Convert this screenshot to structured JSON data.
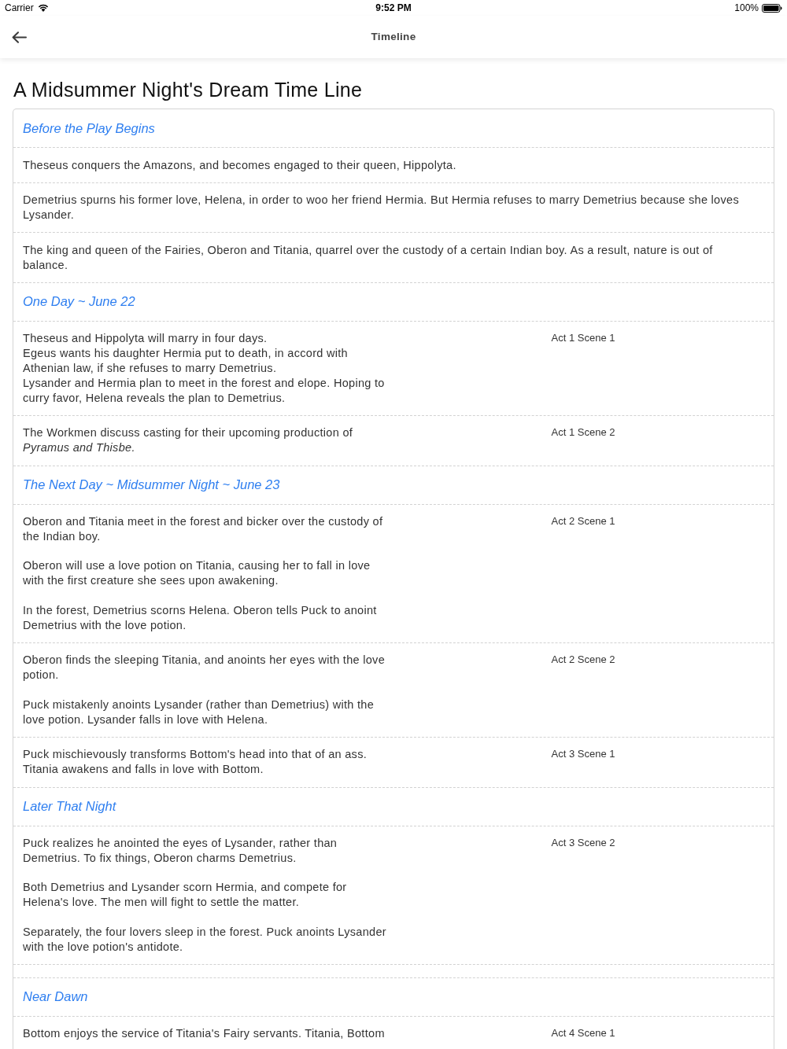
{
  "status_bar": {
    "carrier": "Carrier",
    "time": "9:52 PM",
    "battery": "100%"
  },
  "nav_bar": {
    "title": "Timeline"
  },
  "page_title": "A Midsummer Night's Dream Time Line",
  "sections": [
    {
      "title": "Before the Play Begins",
      "rows": [
        {
          "kind": "event",
          "text": "Theseus conquers the Amazons, and becomes engaged to their queen, Hippolyta."
        },
        {
          "kind": "event",
          "text": "Demetrius spurns his former love, Helena, in order to woo her friend Hermia. But Hermia refuses to marry Demetrius because she loves Lysander."
        },
        {
          "kind": "event",
          "text": "The king and queen of the Fairies, Oberon and Titania, quarrel over the custody of a certain Indian boy. As a result, nature is out of balance."
        }
      ]
    },
    {
      "title": "One Day ~ June 22",
      "rows": [
        {
          "kind": "event",
          "text": "Theseus and Hippolyta will marry in four days.\nEgeus wants his daughter Hermia put to death, in accord with Athenian law, if she refuses to marry Demetrius.\nLysander and Hermia plan to meet in the forest and elope. Hoping to curry favor, Helena reveals the plan to Demetrius.",
          "scene": "Act 1 Scene 1"
        },
        {
          "kind": "event",
          "text": "The Workmen discuss casting for their upcoming production of *Pyramus and Thisbe.*",
          "scene": "Act 1 Scene 2"
        }
      ]
    },
    {
      "title": "The Next Day ~ Midsummer Night ~ June 23",
      "rows": [
        {
          "kind": "event",
          "text": "Oberon and Titania meet in the forest and bicker over the custody of the Indian boy.\n\nOberon will use a love potion on Titania, causing her to fall in love with the first creature she sees upon awakening.\n\nIn the forest, Demetrius scorns Helena. Oberon tells Puck to anoint Demetrius with the love potion.",
          "scene": "Act 2 Scene 1"
        },
        {
          "kind": "event",
          "text": "Oberon finds the sleeping Titania, and anoints her eyes with the love potion.\n\nPuck mistakenly anoints Lysander (rather than Demetrius) with the love potion. Lysander falls in love with Helena.",
          "scene": "Act 2 Scene 2"
        },
        {
          "kind": "event",
          "text": "Puck mischievously transforms Bottom's head into that of an ass.\nTitania awakens and falls in love with Bottom.",
          "scene": "Act 3 Scene 1"
        }
      ]
    },
    {
      "title": "Later That Night",
      "rows": [
        {
          "kind": "event",
          "text": "Puck realizes he anointed the eyes of Lysander, rather than Demetrius. To fix things, Oberon charms Demetrius.\n\nBoth Demetrius and Lysander scorn Hermia, and compete for Helena's love. The men will fight to settle the matter.\n\nSeparately, the four lovers sleep in the forest. Puck anoints Lysander with the love potion's antidote.",
          "scene": "Act 3 Scene 2"
        },
        {
          "kind": "blank"
        }
      ]
    },
    {
      "title": "Near Dawn",
      "rows": [
        {
          "kind": "event",
          "text": "Bottom enjoys the service of Titania's Fairy servants. Titania, Bottom",
          "scene": "Act 4 Scene 1"
        }
      ]
    }
  ]
}
